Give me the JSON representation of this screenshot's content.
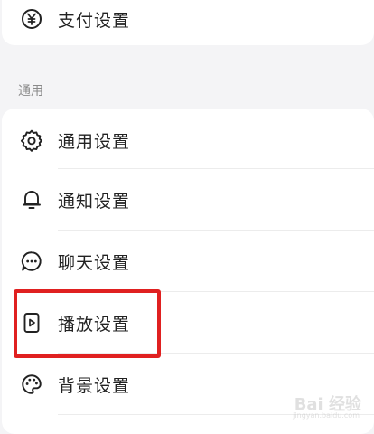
{
  "top_card": {
    "payment_settings": {
      "label": "支付设置",
      "icon": "yen-circle-icon"
    }
  },
  "general_section": {
    "title": "通用",
    "items": [
      {
        "label": "通用设置",
        "icon": "gear-icon"
      },
      {
        "label": "通知设置",
        "icon": "bell-icon"
      },
      {
        "label": "聊天设置",
        "icon": "chat-bubble-icon"
      },
      {
        "label": "播放设置",
        "icon": "play-box-icon"
      },
      {
        "label": "背景设置",
        "icon": "palette-icon"
      }
    ]
  },
  "highlight_color": "#e02020",
  "watermark": {
    "text": "Bai 经验",
    "subtext": "jingyan.baidu.com"
  }
}
